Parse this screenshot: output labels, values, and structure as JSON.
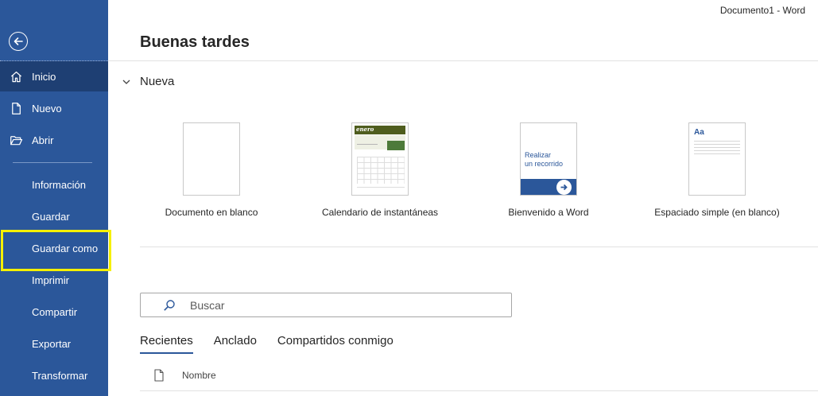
{
  "window": {
    "title": "Documento1  -  Word"
  },
  "sidebar": {
    "items": [
      {
        "label": "Inicio",
        "icon": "home-icon"
      },
      {
        "label": "Nuevo",
        "icon": "new-document-icon"
      },
      {
        "label": "Abrir",
        "icon": "folder-open-icon"
      },
      {
        "label": "Información"
      },
      {
        "label": "Guardar"
      },
      {
        "label": "Guardar como"
      },
      {
        "label": "Imprimir"
      },
      {
        "label": "Compartir"
      },
      {
        "label": "Exportar"
      },
      {
        "label": "Transformar"
      }
    ]
  },
  "main": {
    "greeting": "Buenas tardes",
    "new_section": "Nueva",
    "templates": [
      {
        "label": "Documento en blanco"
      },
      {
        "label": "Calendario de instantáneas",
        "thumb_text": "enero"
      },
      {
        "label": "Bienvenido a Word",
        "thumb_text_1": "Realizar",
        "thumb_text_2": "un recorrido"
      },
      {
        "label": "Espaciado simple (en blanco)",
        "thumb_text": "Aa"
      }
    ],
    "search": {
      "placeholder": "Buscar"
    },
    "tabs": [
      {
        "label": "Recientes"
      },
      {
        "label": "Anclado"
      },
      {
        "label": "Compartidos conmigo"
      }
    ],
    "file_list": {
      "column_name": "Nombre"
    }
  },
  "colors": {
    "sidebar_bg": "#2b579a",
    "sidebar_active": "#1e3f73",
    "highlight": "#f5f000"
  }
}
